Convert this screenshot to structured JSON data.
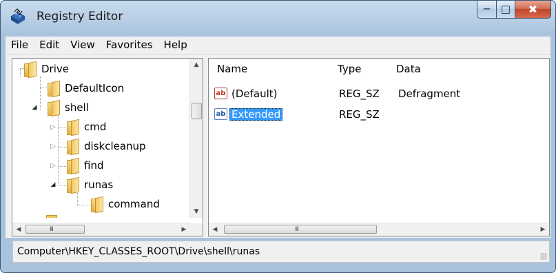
{
  "window": {
    "title": "Registry Editor"
  },
  "menu": [
    "File",
    "Edit",
    "View",
    "Favorites",
    "Help"
  ],
  "tree": {
    "items": [
      {
        "label": "Drive",
        "level": 0,
        "expander": "none"
      },
      {
        "label": "DefaultIcon",
        "level": 1,
        "expander": "none"
      },
      {
        "label": "shell",
        "level": 1,
        "expander": "expanded"
      },
      {
        "label": "cmd",
        "level": 2,
        "expander": "collapsed"
      },
      {
        "label": "diskcleanup",
        "level": 2,
        "expander": "collapsed"
      },
      {
        "label": "find",
        "level": 2,
        "expander": "collapsed"
      },
      {
        "label": "runas",
        "level": 2,
        "expander": "expanded"
      },
      {
        "label": "command",
        "level": 3,
        "expander": "none"
      }
    ],
    "hscroll_grip": "III"
  },
  "list": {
    "columns": {
      "name": "Name",
      "type": "Type",
      "data": "Data"
    },
    "rows": [
      {
        "icon_text": "ab",
        "name": "(Default)",
        "type": "REG_SZ",
        "data": "Defragment",
        "selected": false
      },
      {
        "icon_text": "ab",
        "name": "Extended",
        "type": "REG_SZ",
        "data": "",
        "selected": true
      }
    ],
    "hscroll_grip": "III"
  },
  "status": {
    "path": "Computer\\HKEY_CLASSES_ROOT\\Drive\\shell\\runas"
  },
  "icons": {
    "app": "registry-editor-icon",
    "minimize": "minimize-icon",
    "maximize": "maximize-icon",
    "close": "close-icon",
    "folder": "folder-icon",
    "value": "string-value-icon"
  },
  "colors": {
    "selection": "#3399ff",
    "close_button": "#c1442a",
    "titlebar": "#b7cde4"
  }
}
